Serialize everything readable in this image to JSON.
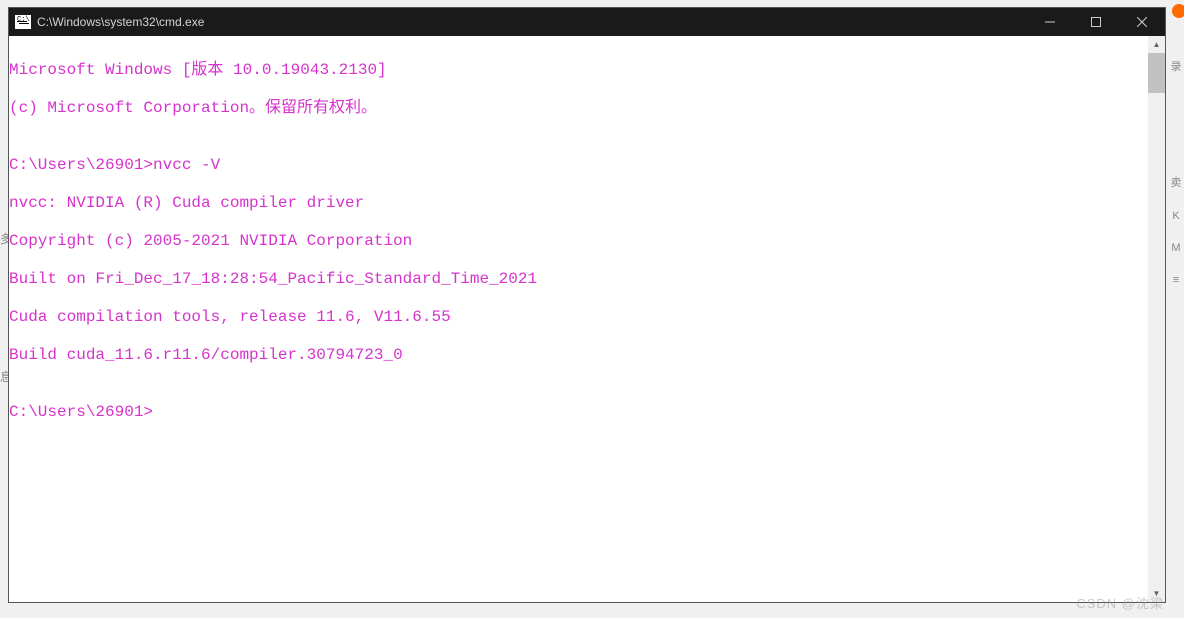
{
  "window": {
    "title": "C:\\Windows\\system32\\cmd.exe"
  },
  "terminal": {
    "lines": [
      "Microsoft Windows [版本 10.0.19043.2130]",
      "(c) Microsoft Corporation。保留所有权利。",
      "",
      "C:\\Users\\26901>nvcc -V",
      "nvcc: NVIDIA (R) Cuda compiler driver",
      "Copyright (c) 2005-2021 NVIDIA Corporation",
      "Built on Fri_Dec_17_18:28:54_Pacific_Standard_Time_2021",
      "Cuda compilation tools, release 11.6, V11.6.55",
      "Build cuda_11.6.r11.6/compiler.30794723_0",
      "",
      "C:\\Users\\26901>"
    ]
  },
  "background": {
    "left_chars": {
      "a": "多",
      "b": "息"
    },
    "right_chars": {
      "a": "录",
      "b": "卖",
      "c": "K",
      "d": "M"
    },
    "hamburger": "≡",
    "watermark": "CSDN @沈梁"
  }
}
